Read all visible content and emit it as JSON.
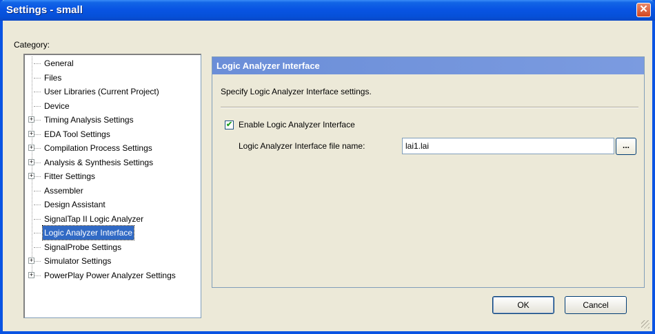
{
  "window": {
    "title": "Settings - small"
  },
  "category_label": "Category:",
  "tree": [
    {
      "label": "General",
      "expandable": false
    },
    {
      "label": "Files",
      "expandable": false
    },
    {
      "label": "User Libraries (Current Project)",
      "expandable": false
    },
    {
      "label": "Device",
      "expandable": false
    },
    {
      "label": "Timing Analysis Settings",
      "expandable": true
    },
    {
      "label": "EDA Tool Settings",
      "expandable": true
    },
    {
      "label": "Compilation Process Settings",
      "expandable": true
    },
    {
      "label": "Analysis & Synthesis Settings",
      "expandable": true
    },
    {
      "label": "Fitter Settings",
      "expandable": true
    },
    {
      "label": "Assembler",
      "expandable": false
    },
    {
      "label": "Design Assistant",
      "expandable": false
    },
    {
      "label": "SignalTap II Logic Analyzer",
      "expandable": false
    },
    {
      "label": "Logic Analyzer Interface",
      "expandable": false,
      "selected": true
    },
    {
      "label": "SignalProbe Settings",
      "expandable": false
    },
    {
      "label": "Simulator Settings",
      "expandable": true
    },
    {
      "label": "PowerPlay Power Analyzer Settings",
      "expandable": true
    }
  ],
  "panel": {
    "header": "Logic Analyzer Interface",
    "description": "Specify Logic Analyzer Interface settings.",
    "enable_label": "Enable Logic Analyzer Interface",
    "enable_checked": true,
    "file_label": "Logic Analyzer Interface file name:",
    "file_value": "lai1.lai",
    "browse_label": "..."
  },
  "buttons": {
    "ok": "OK",
    "cancel": "Cancel"
  },
  "icons": {
    "close": "close-icon",
    "checkmark": "check-icon",
    "expand": "plus-icon"
  }
}
